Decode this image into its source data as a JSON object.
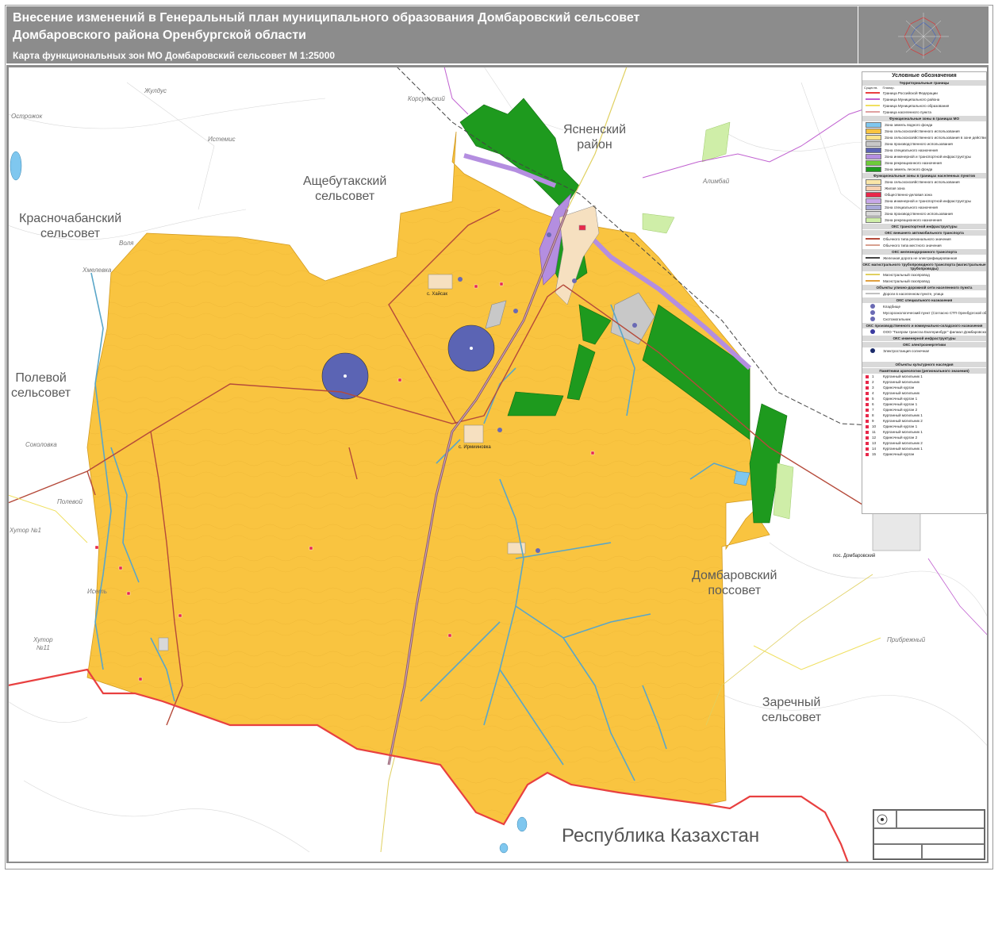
{
  "header": {
    "title_line1": "Внесение изменений в Генеральный план муниципального образования Домбаровский сельсовет",
    "title_line2": "Домбаровского района Оренбургской области",
    "subtitle": "Карта функциональных зон МО Домбаровский сельсовет М 1:25000"
  },
  "map": {
    "colors": {
      "agricultural_zone": "#f9c440",
      "forest_zone": "#1e9a1e",
      "engineering_zone": "#b48ee0",
      "special_zone": "#5b64b4",
      "industrial_zone": "#c8c8c8",
      "state_border": "#e84040",
      "municipal_border": "#c060d0",
      "settlement_border": "#f0e060",
      "river": "#5aa6c8",
      "road": "#b54a3a",
      "railway": "#555555"
    },
    "labels": {
      "yasnenskiy": "Ясненский\nрайон",
      "ashchebutak": "Ащебутакский\nсельсовет",
      "krasnochaban": "Красночабанский\nсельсовет",
      "polevoy": "Полевой\nсельсовет",
      "dombarovskiy_pos": "Домбаровский\nпоссовет",
      "zarechny": "Заречный\nсельсовет",
      "kazakhstan": "Республика Казахстан"
    },
    "place_names": {
      "ostrozhok": "Острожок",
      "zhuldus": "Жулдус",
      "istemis": "Истемис",
      "volya": "Воля",
      "khmelevka": "Хмелевка",
      "sokolovka": "Соколовка",
      "polevoy_v": "Полевой",
      "khutor1": "Хутор №1",
      "iset": "Исеть",
      "khutor11": "Хутор\n№11",
      "korsuskiy": "Корсуньский",
      "alimbay": "Алимбай",
      "pribrezhny": "Прибрежный",
      "pos_dombarovsky": "пос. Домбаровский",
      "s_khaysak": "с. Хайсак",
      "s_zhanakhtyk": "с. Ирмииновка"
    }
  },
  "legend": {
    "title": "Условные обозначения",
    "sections": [
      {
        "header": "Территориальные границы",
        "cols": [
          "Существ.",
          "Планир."
        ],
        "items": [
          {
            "label": "Граница Российской Федерации",
            "kind": "line",
            "color": "#e84040"
          },
          {
            "label": "Граница Муниципального района",
            "kind": "line",
            "color": "#c060d0"
          },
          {
            "label": "Граница Муниципального образования",
            "kind": "line",
            "color": "#f0e060"
          },
          {
            "label": "Граница населенного пункта",
            "kind": "line",
            "color": "#e0a0a0"
          }
        ]
      },
      {
        "header": "Функциональные зоны в границах МО",
        "items": [
          {
            "label": "Зона земель водного фонда",
            "kind": "fill",
            "color": "#7fc7ef"
          },
          {
            "label": "Зона сельскохозяйственного использования",
            "kind": "fill",
            "color": "#f9c440"
          },
          {
            "label": "Зона сельскохозяйственного использования в зоне действия водоохранных зон",
            "kind": "fill",
            "color": "#fbe38c"
          },
          {
            "label": "Зона производственного использования",
            "kind": "fill",
            "color": "#c8c8c8"
          },
          {
            "label": "Зона специального назначения",
            "kind": "fill",
            "color": "#5b64b4"
          },
          {
            "label": "Зона инженерной и транспортной инфраструктуры",
            "kind": "fill",
            "color": "#b48ee0"
          },
          {
            "label": "Зона рекреационного назначения",
            "kind": "fill",
            "color": "#6ecb3a"
          },
          {
            "label": "Зона земель лесного фонда",
            "kind": "fill",
            "color": "#1e9a1e"
          }
        ]
      },
      {
        "header": "Функциональные зоны в границах населенных пунктов",
        "items": [
          {
            "label": "Зона сельскохозяйственного использования",
            "kind": "fill",
            "color": "#f9e6a8"
          },
          {
            "label": "Жилая зона",
            "kind": "fill",
            "color": "#f6d0b0"
          },
          {
            "label": "Общественно-деловая зона",
            "kind": "fill",
            "color": "#e8284a"
          },
          {
            "label": "Зона инженерной и транспортной инфраструктуры",
            "kind": "fill",
            "color": "#c8a8e8"
          },
          {
            "label": "Зона специального назначения",
            "kind": "fill",
            "color": "#a8a8d8"
          },
          {
            "label": "Зона производственного использования",
            "kind": "fill",
            "color": "#d8d8d8"
          },
          {
            "label": "Зона рекреационного назначения",
            "kind": "fill",
            "color": "#cfeea8"
          }
        ]
      },
      {
        "header": "ОКС транспортной инфраструктуры",
        "items": []
      },
      {
        "header": "ОКС внешнего автомобильного транспорта",
        "items": [
          {
            "label": "Обычного типа регионального значения",
            "kind": "line",
            "color": "#b54a3a"
          },
          {
            "label": "Обычного типа местного значения",
            "kind": "line",
            "color": "#d8a090"
          }
        ]
      },
      {
        "header": "ОКС железнодорожного транспорта",
        "items": [
          {
            "label": "Железная дорога не электрифицированная",
            "kind": "line",
            "color": "#444444"
          }
        ]
      },
      {
        "header": "ОКС магистрального трубопроводного транспорта (магистральные трубопроводы)",
        "items": [
          {
            "label": "Магистральный газопровод",
            "kind": "line",
            "color": "#e0d060"
          },
          {
            "label": "Магистральный газопровод",
            "kind": "line",
            "color": "#e0a040"
          }
        ]
      },
      {
        "header": "Объекты улично-дорожной сети населенного пункта",
        "items": [
          {
            "label": "Дороги в населенном пункте, улица",
            "kind": "line",
            "color": "#c0c0c0"
          }
        ]
      },
      {
        "header": "ОКС специального назначения",
        "items": [
          {
            "label": "Кладбище",
            "kind": "icon",
            "color": "#6a6ab4"
          },
          {
            "label": "Мусороэкологический пункт (Согласно СТП Оренбургской области)",
            "kind": "icon",
            "color": "#6a6ab4"
          },
          {
            "label": "Скотомогильник",
            "kind": "icon",
            "color": "#6a6ab4"
          }
        ]
      },
      {
        "header": "ОКС производственного и коммунально-складского назначения",
        "items": [
          {
            "label": "ООО \"Газпром трансгаз Екатеринбург\" филиал Домбаровское ЛПУ МГ Щебеночный завод",
            "kind": "icon",
            "color": "#3a3aa0"
          }
        ]
      },
      {
        "header": "ОКС инженерной инфраструктуры",
        "items": []
      },
      {
        "header": "ОКС электроэнергетики",
        "items": [
          {
            "label": "Электростанция солнечная",
            "kind": "icon",
            "color": "#1a2a6a"
          }
        ]
      }
    ],
    "heritage_title": "Объекты культурного наследия",
    "heritage_sub": "Памятники археологии (регионального значения)",
    "heritage": [
      "Курганный могильник 1",
      "Курганный могильник",
      "Одиночный курган",
      "Курганный могильник",
      "Одиночный курган 1",
      "Одиночный курган 1",
      "Одиночный курган 2",
      "Курганный могильник 1",
      "Курганный могильник 2",
      "Одиночный курган 1",
      "Курганный могильник 1",
      "Одиночный курган 2",
      "Курганный могильник 2",
      "Курганный могильник 1",
      "Одиночный курган"
    ],
    "heritage_nums": [
      "1",
      "2",
      "3",
      "4",
      "5",
      "6",
      "7",
      "8",
      "9",
      "10",
      "11",
      "12",
      "13",
      "14",
      "15"
    ]
  }
}
